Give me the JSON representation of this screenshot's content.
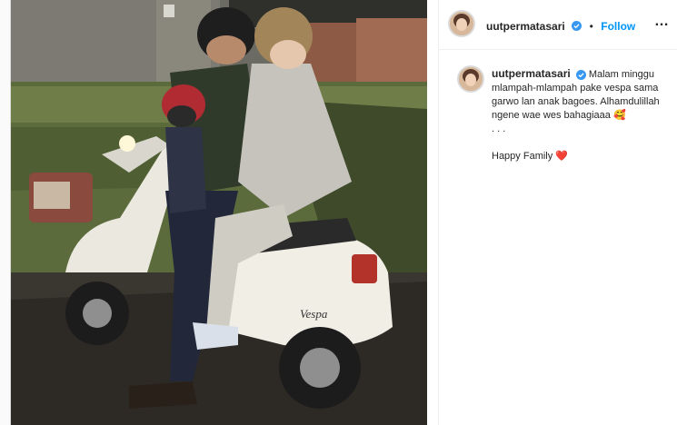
{
  "header": {
    "username": "uutpermatasari",
    "separator": "•",
    "follow_label": "Follow",
    "more_icon": "…"
  },
  "caption": {
    "username": "uutpermatasari",
    "text": "Malam minggu mlampah-mlampah pake vespa sama garwo lan anak bagoes. Alhamdulillah ngene wae wes bahagiaaa",
    "emoji": "🥰",
    "dots": ". . .",
    "closing": "Happy Family",
    "closing_emoji": "❤️"
  },
  "photo": {
    "logo_text": "Vespa"
  },
  "colors": {
    "accent": "#0095f6",
    "verified": "#3897f0"
  }
}
